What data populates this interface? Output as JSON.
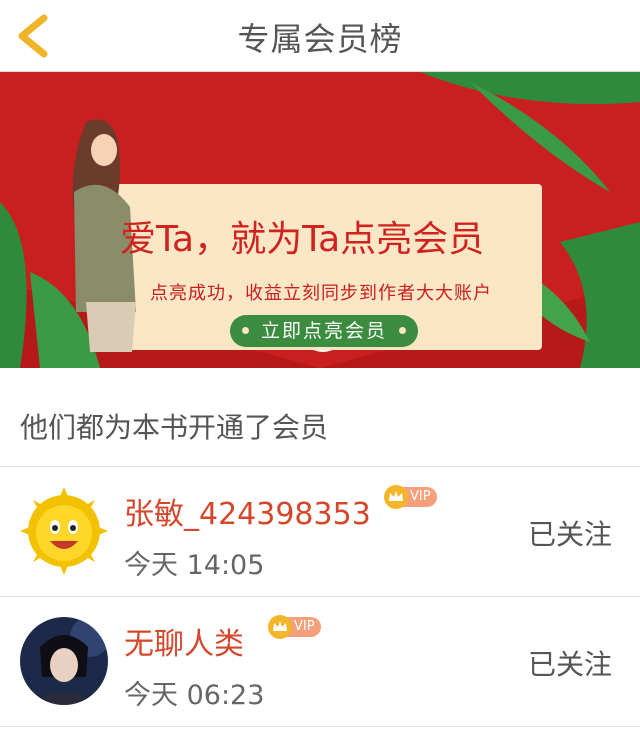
{
  "header": {
    "title": "专属会员榜",
    "back_icon": "chevron-left-icon"
  },
  "banner": {
    "slogan": "爱Ta，就为Ta点亮会员",
    "subline": "点亮成功，收益立刻同步到作者大大账户",
    "cta_label": "立即点亮会员",
    "colors": {
      "background": "#c9201f",
      "card": "#fbe6c6",
      "cta": "#3c8c3f"
    }
  },
  "section": {
    "title": "他们都为本书开通了会员"
  },
  "members": [
    {
      "name": "张敏_424398353",
      "badge": "VIP",
      "time": "今天 14:05",
      "follow_label": "已关注",
      "avatar_icon": "sun-face-avatar"
    },
    {
      "name": "无聊人类",
      "badge": "VIP",
      "time": "今天 06:23",
      "follow_label": "已关注",
      "avatar_icon": "portrait-avatar"
    }
  ],
  "colors": {
    "accent": "#d5472b",
    "back_arrow": "#f0b429"
  }
}
